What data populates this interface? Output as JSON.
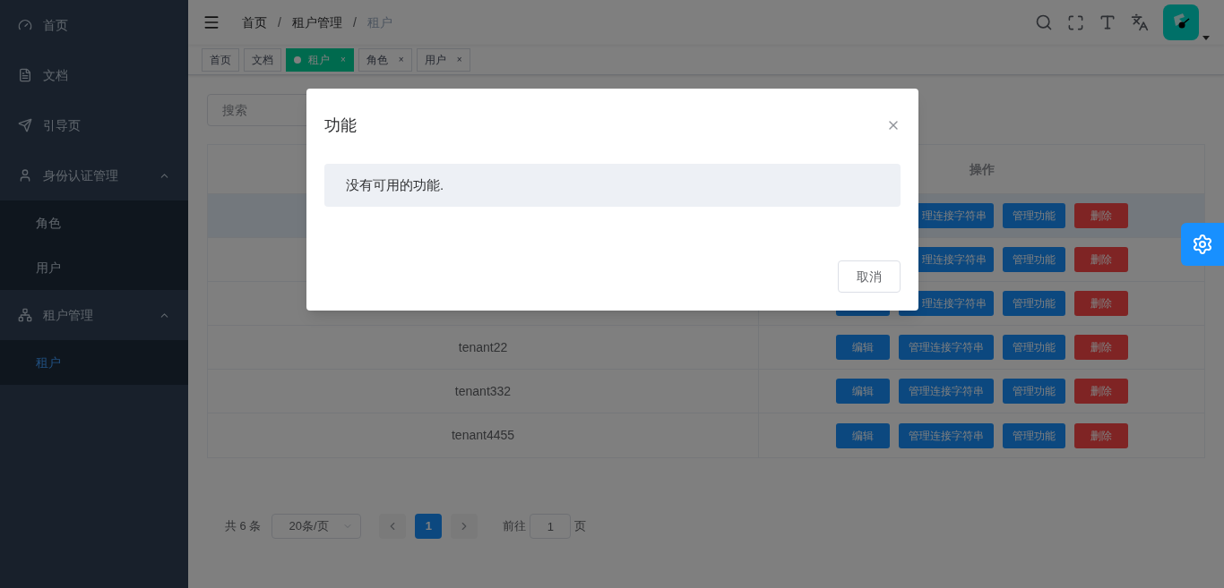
{
  "sidebar": {
    "items": [
      {
        "label": "首页"
      },
      {
        "label": "文档"
      },
      {
        "label": "引导页"
      },
      {
        "label": "身份认证管理",
        "expanded": true,
        "children": [
          {
            "label": "角色",
            "selected": false
          },
          {
            "label": "用户",
            "selected": false
          }
        ]
      },
      {
        "label": "租户管理",
        "expanded": true,
        "children": [
          {
            "label": "租户",
            "selected": true
          }
        ]
      }
    ]
  },
  "breadcrumb": [
    "首页",
    "租户管理",
    "租户"
  ],
  "breadcrumb_separator": "/",
  "tags": [
    {
      "label": "首页",
      "selected": false,
      "closable": false
    },
    {
      "label": "文档",
      "selected": false,
      "closable": false
    },
    {
      "label": "租户",
      "selected": true,
      "closable": true
    },
    {
      "label": "角色",
      "selected": false,
      "closable": true
    },
    {
      "label": "用户",
      "selected": false,
      "closable": true
    }
  ],
  "close_mark": "×",
  "search": {
    "placeholder": "搜索"
  },
  "table": {
    "columns": [
      "操作"
    ],
    "rows": [
      {
        "hovered": true,
        "partly_hidden": true,
        "actions": [
          "理连接字符串",
          "管理功能",
          "删除"
        ]
      },
      {
        "hovered": false,
        "partly_hidden": true,
        "actions": [
          "理连接字符串",
          "管理功能",
          "删除"
        ]
      },
      {
        "hovered": false,
        "partly_hidden": true,
        "actions": [
          "理连接字符串",
          "管理功能",
          "删除"
        ]
      },
      {
        "hovered": false,
        "name": "tenant22",
        "actions": [
          "编辑",
          "管理连接字符串",
          "管理功能",
          "删除"
        ]
      },
      {
        "hovered": false,
        "name": "tenant332",
        "actions": [
          "编辑",
          "管理连接字符串",
          "管理功能",
          "删除"
        ]
      },
      {
        "hovered": false,
        "name": "tenant4455",
        "actions": [
          "编辑",
          "管理连接字符串",
          "管理功能",
          "删除"
        ]
      }
    ]
  },
  "pagination": {
    "total": "共 6 条",
    "page_size": "20条/页",
    "pages": [
      {
        "label": "1",
        "selected": true
      }
    ],
    "goto_label": "前往",
    "goto_value": "1",
    "goto_suffix": "页"
  },
  "dialog": {
    "title": "功能",
    "message": "没有可用的功能.",
    "buttons": [
      "取消"
    ]
  }
}
